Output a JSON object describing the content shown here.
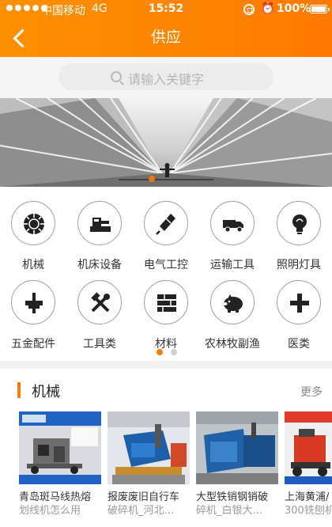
{
  "status_bar": {
    "carrier": "中国移动",
    "network": "4G",
    "time": "15:52",
    "battery": "100%"
  },
  "header": {
    "title": "供应",
    "back_icon": "back-chevron-icon"
  },
  "search": {
    "placeholder": "请输入关键字",
    "icon": "search-icon"
  },
  "banner": {
    "slide_count": 1,
    "active_index": 0
  },
  "categories": [
    {
      "label": "机械",
      "icon": "gear-icon"
    },
    {
      "label": "机床设备",
      "icon": "machine-tool-icon"
    },
    {
      "label": "电气工控",
      "icon": "electrical-icon"
    },
    {
      "label": "运输工具",
      "icon": "truck-icon"
    },
    {
      "label": "照明灯具",
      "icon": "bulb-icon"
    },
    {
      "label": "五金配件",
      "icon": "hardware-icon"
    },
    {
      "label": "工具类",
      "icon": "tools-icon"
    },
    {
      "label": "材料",
      "icon": "materials-icon"
    },
    {
      "label": "农林牧副渔",
      "icon": "pig-icon"
    },
    {
      "label": "医类",
      "icon": "medical-cross-icon"
    }
  ],
  "category_pages": {
    "count": 2,
    "active_index": 0
  },
  "section": {
    "title": "机械",
    "more_label": "更多"
  },
  "products": [
    {
      "name": "青岛斑马线热熔",
      "desc": "划线机怎么用"
    },
    {
      "name": "报废废旧自行车",
      "desc": "破碎机_河北..."
    },
    {
      "name": "大型铁销钢销破",
      "desc": "碎机_白银大..."
    },
    {
      "name": "上海黄浦/",
      "desc": "300铣刨机"
    }
  ],
  "colors": {
    "accent": "#ff7a00",
    "header_start": "#fd9000",
    "text_primary": "#222222",
    "text_secondary": "#999999"
  }
}
